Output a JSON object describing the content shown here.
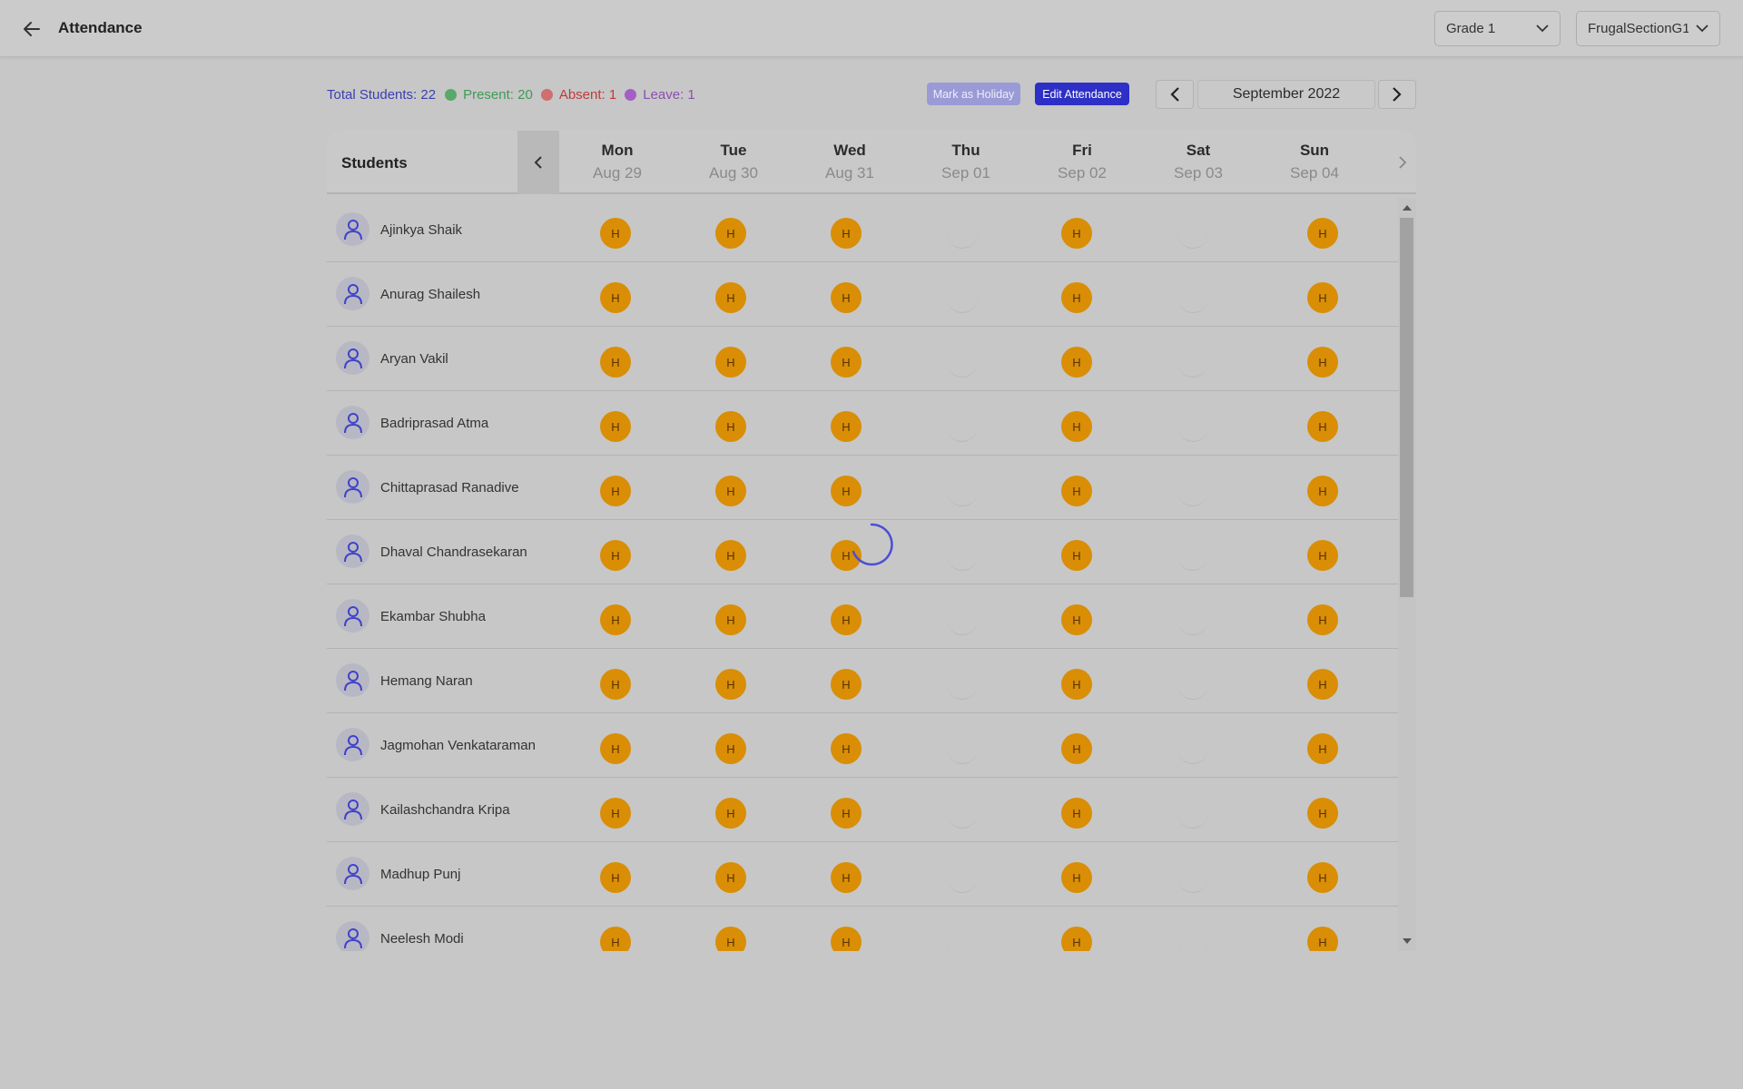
{
  "header": {
    "title": "Attendance",
    "grade_select": "Grade 1",
    "section_select": "FrugalSectionG1"
  },
  "stats": {
    "total": "Total Students: 22",
    "present": "Present: 20",
    "absent": "Absent: 1",
    "leave": "Leave: 1"
  },
  "actions": {
    "mark_holiday": "Mark as Holiday",
    "edit_attendance": "Edit Attendance"
  },
  "month": "September 2022",
  "table": {
    "students_header": "Students",
    "days": [
      {
        "name": "Mon",
        "date": "Aug 29"
      },
      {
        "name": "Tue",
        "date": "Aug 30"
      },
      {
        "name": "Wed",
        "date": "Aug 31"
      },
      {
        "name": "Thu",
        "date": "Sep 01"
      },
      {
        "name": "Fri",
        "date": "Sep 02"
      },
      {
        "name": "Sat",
        "date": "Sep 03"
      },
      {
        "name": "Sun",
        "date": "Sep 04"
      }
    ],
    "mark_label": "H",
    "day_marks": [
      "H",
      "H",
      "H",
      "",
      "H",
      "",
      "H"
    ],
    "students": [
      "Ajinkya Shaik",
      "Anurag Shailesh",
      "Aryan Vakil",
      "Badriprasad Atma",
      "Chittaprasad Ranadive",
      "Dhaval Chandrasekaran",
      "Ekambar Shubha",
      "Hemang Naran",
      "Jagmohan Venkataraman",
      "Kailashchandra Kripa",
      "Madhup Punj",
      "Neelesh Modi"
    ]
  },
  "colors": {
    "present": "#3f9a55",
    "absent": "#c03a3a",
    "leave": "#8a4fb0",
    "holiday_mark": "#d98e06",
    "accent": "#2d2fc6"
  },
  "icons": {
    "back": "arrow-left-icon",
    "dropdown": "chevron-down-icon",
    "prev": "chevron-left-icon",
    "next": "chevron-right-icon",
    "avatar": "user-icon",
    "loading": "spinner-icon"
  }
}
